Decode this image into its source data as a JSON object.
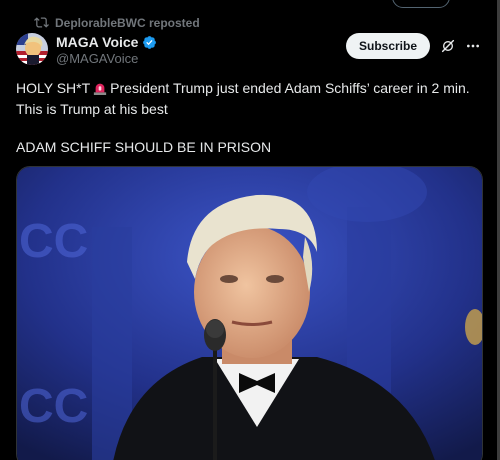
{
  "repost": {
    "label": "DeplorableBWC reposted"
  },
  "author": {
    "name": "MAGA Voice",
    "handle": "@MAGAVoice"
  },
  "actions": {
    "subscribe_label": "Subscribe"
  },
  "tweet": {
    "line1_before": "HOLY SH*T",
    "line1_after": "President Trump just ended Adam Schiffs’ career in 2 min. This is Trump at his best",
    "line2": "ADAM SCHIFF SHOULD BE IN PRISON"
  },
  "media": {
    "backdrop_letters": [
      "CC",
      "CC"
    ]
  },
  "colors": {
    "background": "#000000",
    "text": "#e7e9ea",
    "secondary_text": "#71767b",
    "verified": "#1d9bf0",
    "button_bg": "#eff3f4",
    "stage_blue": "#2b3fa8"
  },
  "icons": {
    "repost": "repost-icon",
    "verified": "verified-badge-icon",
    "grok": "grok-icon",
    "more": "more-icon",
    "siren": "siren-emoji"
  }
}
